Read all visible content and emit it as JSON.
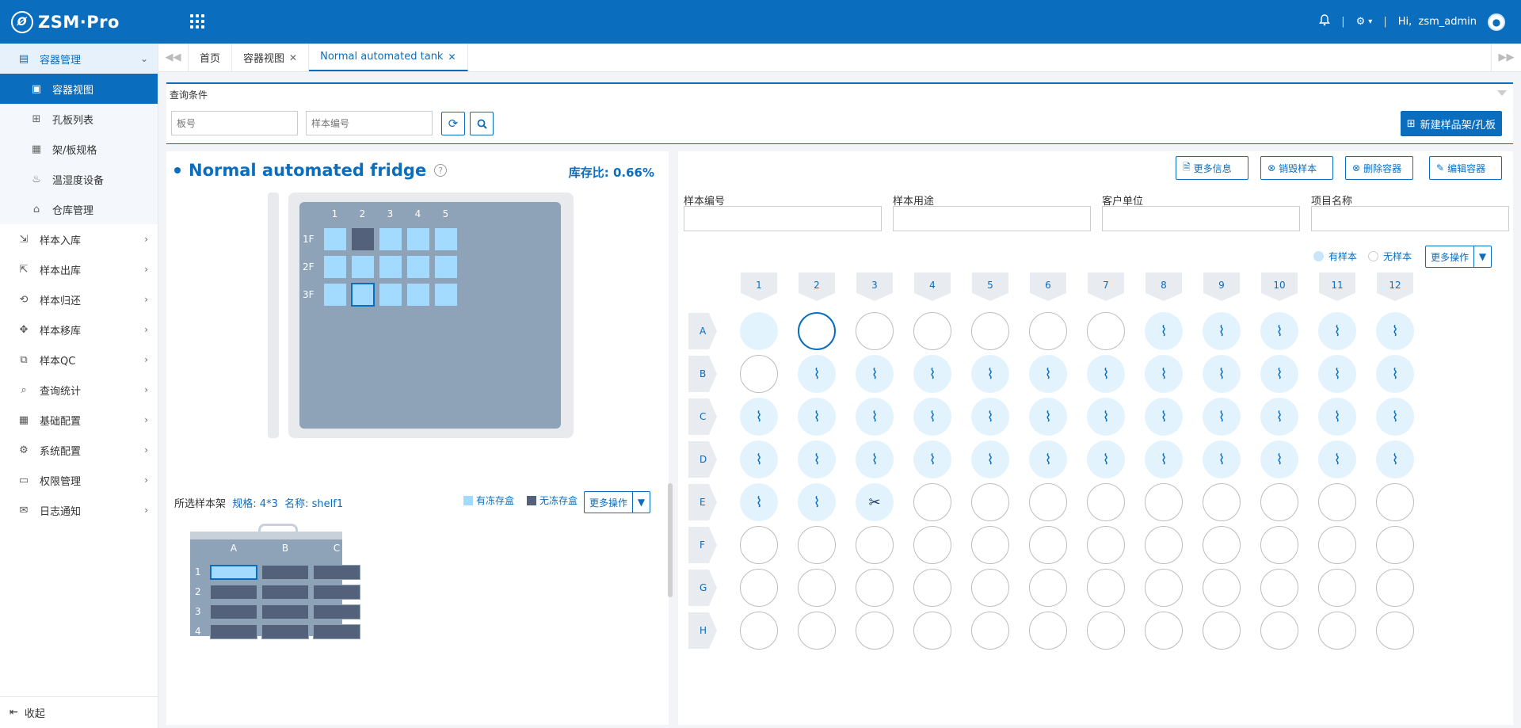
{
  "header": {
    "logo_text": "ZSM·Pro",
    "greeting": "Hi,",
    "username": "zsm_admin",
    "icons": [
      "bell-icon",
      "gear-icon",
      "apps-grid-icon",
      "avatar-icon"
    ]
  },
  "sidebar": {
    "groups": [
      {
        "label": "容器管理",
        "icon": "container-icon",
        "open": true
      },
      {
        "label": "样本入库",
        "icon": "import-icon"
      },
      {
        "label": "样本出库",
        "icon": "export-icon"
      },
      {
        "label": "样本归还",
        "icon": "return-icon"
      },
      {
        "label": "样本移库",
        "icon": "move-icon"
      },
      {
        "label": "样本QC",
        "icon": "qc-icon"
      },
      {
        "label": "查询统计",
        "icon": "search-icon"
      },
      {
        "label": "基础配置",
        "icon": "config-icon"
      },
      {
        "label": "系统配置",
        "icon": "gear-icon"
      },
      {
        "label": "权限管理",
        "icon": "id-card-icon"
      },
      {
        "label": "日志通知",
        "icon": "mail-icon"
      }
    ],
    "sub_items": [
      {
        "label": "容器视图",
        "active": true
      },
      {
        "label": "孔板列表"
      },
      {
        "label": "架/板规格"
      },
      {
        "label": "温湿度设备"
      },
      {
        "label": "仓库管理"
      }
    ],
    "collapse_label": "收起"
  },
  "tabs": [
    {
      "label": "首页",
      "closable": false
    },
    {
      "label": "容器视图",
      "closable": true
    },
    {
      "label": "Normal automated tank",
      "closable": true,
      "active": true
    }
  ],
  "query": {
    "title": "查询条件",
    "plate_placeholder": "板号",
    "sample_placeholder": "样本编号",
    "new_button": "新建样品架/孔板"
  },
  "fridge": {
    "title": "Normal automated fridge",
    "ratio_label": "库存比:",
    "ratio_value": "0.66%",
    "columns": [
      "1",
      "2",
      "3",
      "4",
      "5"
    ],
    "rows": [
      "1F",
      "2F",
      "3F"
    ],
    "occupied": [
      [
        0,
        1
      ]
    ],
    "selected": [
      [
        2,
        1
      ]
    ]
  },
  "shelf": {
    "label": "所选样本架",
    "spec": "规格: 4*3",
    "name": "名称: shelf1",
    "legend_frozen": "有冻存盒",
    "legend_empty": "无冻存盒",
    "more_ops": "更多操作",
    "columns": [
      "A",
      "B",
      "C"
    ],
    "rows": [
      "1",
      "2",
      "3",
      "4"
    ],
    "selected": [
      0,
      0
    ]
  },
  "plate": {
    "buttons": [
      "更多信息",
      "销毁样本",
      "删除容器",
      "编辑容器"
    ],
    "fields": [
      "样本编号",
      "样本用途",
      "客户单位",
      "项目名称"
    ],
    "radio_has": "有样本",
    "radio_none": "无样本",
    "more_ops": "更多操作",
    "columns": [
      "1",
      "2",
      "3",
      "4",
      "5",
      "6",
      "7",
      "8",
      "9",
      "10",
      "11",
      "12"
    ],
    "rows": [
      "A",
      "B",
      "C",
      "D",
      "E",
      "F",
      "G",
      "H"
    ],
    "wells": [
      [
        "f",
        "s",
        "e",
        "e",
        "e",
        "e",
        "e",
        "d",
        "d",
        "d",
        "d",
        "d"
      ],
      [
        "e",
        "d",
        "d",
        "d",
        "d",
        "d",
        "d",
        "d",
        "d",
        "d",
        "d",
        "d"
      ],
      [
        "d",
        "d",
        "d",
        "d",
        "d",
        "d",
        "d",
        "d",
        "d",
        "d",
        "d",
        "d"
      ],
      [
        "d",
        "d",
        "d",
        "d",
        "d",
        "d",
        "d",
        "d",
        "d",
        "d",
        "d",
        "d"
      ],
      [
        "d",
        "d",
        "x",
        "e",
        "e",
        "e",
        "e",
        "e",
        "e",
        "e",
        "e",
        "e"
      ],
      [
        "e",
        "e",
        "e",
        "e",
        "e",
        "e",
        "e",
        "e",
        "e",
        "e",
        "e",
        "e"
      ],
      [
        "e",
        "e",
        "e",
        "e",
        "e",
        "e",
        "e",
        "e",
        "e",
        "e",
        "e",
        "e"
      ],
      [
        "e",
        "e",
        "e",
        "e",
        "e",
        "e",
        "e",
        "e",
        "e",
        "e",
        "e",
        "e"
      ]
    ],
    "colors": {
      "accent": "#0b6dbe",
      "sample_bg": "#e3f3fd"
    }
  }
}
